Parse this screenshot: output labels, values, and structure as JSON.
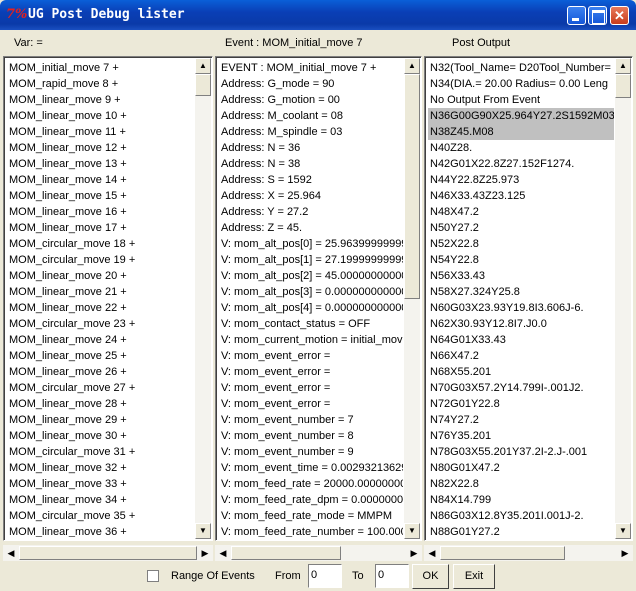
{
  "window": {
    "title": "UG Post Debug lister",
    "logo": "7%"
  },
  "headers": {
    "var": "Var:   =",
    "event": "Event : MOM_initial_move 7",
    "post_output": "Post Output"
  },
  "events": [
    "MOM_initial_move 7      +",
    "MOM_rapid_move 8          +",
    "MOM_linear_move 9          +",
    "MOM_linear_move 10        +",
    "MOM_linear_move 11        +",
    "MOM_linear_move 12        +",
    "MOM_linear_move 13        +",
    "MOM_linear_move 14        +",
    "MOM_linear_move 15        +",
    "MOM_linear_move 16        +",
    "MOM_linear_move 17        +",
    "MOM_circular_move 18     +",
    "MOM_circular_move 19     +",
    "MOM_linear_move 20        +",
    "MOM_linear_move 21        +",
    "MOM_linear_move 22        +",
    "MOM_circular_move 23     +",
    "MOM_linear_move 24        +",
    "MOM_linear_move 25        +",
    "MOM_linear_move 26        +",
    "MOM_circular_move 27     +",
    "MOM_linear_move 28        +",
    "MOM_linear_move 29        +",
    "MOM_linear_move 30        +",
    "MOM_circular_move 31     +",
    "MOM_linear_move 32        +",
    "MOM_linear_move 33        +",
    "MOM_linear_move 34        +",
    "MOM_circular_move 35     +",
    "MOM_linear_move 36        +"
  ],
  "details": [
    "EVENT :  MOM_initial_move 7 +",
    "Address:  G_mode = 90",
    "Address:  G_motion = 00",
    "Address:  M_coolant = 08",
    "Address:  M_spindle = 03",
    "Address:  N = 36",
    "Address:  N = 38",
    "Address:  S = 1592",
    "Address:  X = 25.964",
    "Address:  Y = 27.2",
    "Address:  Z = 45.",
    "V:  mom_alt_pos[0] = 25.96399999999",
    "V:  mom_alt_pos[1] = 27.19999999999",
    "V:  mom_alt_pos[2] = 45.00000000000",
    "V:  mom_alt_pos[3] = 0.000000000000",
    "V:  mom_alt_pos[4] = 0.000000000000",
    "V:  mom_contact_status = OFF",
    "V:  mom_current_motion = initial_move",
    "V:  mom_event_error =",
    "V:  mom_event_error =",
    "V:  mom_event_error =",
    "V:  mom_event_error =",
    "V:  mom_event_number = 7",
    "V:  mom_event_number = 8",
    "V:  mom_event_number = 9",
    "V:  mom_event_time = 0.00293213629",
    "V:  mom_feed_rate = 20000.00000000",
    "V:  mom_feed_rate_dpm = 0.000000000",
    "V:  mom_feed_rate_mode = MMPM",
    "V:  mom_feed_rate_number = 100.000"
  ],
  "output": [
    "N32(Tool_Name= D20Tool_Number=",
    "N34(DIA.= 20.00  Radius= 0.00  Leng",
    "No Output From Event",
    "N36G00G90X25.964Y27.2S1592M03",
    "N38Z45.M08",
    "N40Z28.",
    "N42G01X22.8Z27.152F1274.",
    "N44Y22.8Z25.973",
    "N46X33.43Z23.125",
    "N48X47.2",
    "N50Y27.2",
    "N52X22.8",
    "N54Y22.8",
    "N56X33.43",
    "N58X27.324Y25.8",
    "N60G03X23.93Y19.8I3.606J-6.",
    "N62X30.93Y12.8I7.J0.0",
    "N64G01X33.43",
    "N66X47.2",
    "N68X55.201",
    "N70G03X57.2Y14.799I-.001J2.",
    "N72G01Y22.8",
    "N74Y27.2",
    "N76Y35.201",
    "N78G03X55.201Y37.2I-2.J-.001",
    "N80G01X47.2",
    "N82X22.8",
    "N84X14.799",
    "N86G03X12.8Y35.201I.001J-2.",
    "N88G01Y27.2"
  ],
  "output_selected": [
    3,
    4
  ],
  "controls": {
    "range_of_events": "Range Of Events",
    "from_label": "From",
    "from_value": "0",
    "to_label": "To",
    "to_value": "0",
    "ok": "OK",
    "exit": "Exit"
  }
}
